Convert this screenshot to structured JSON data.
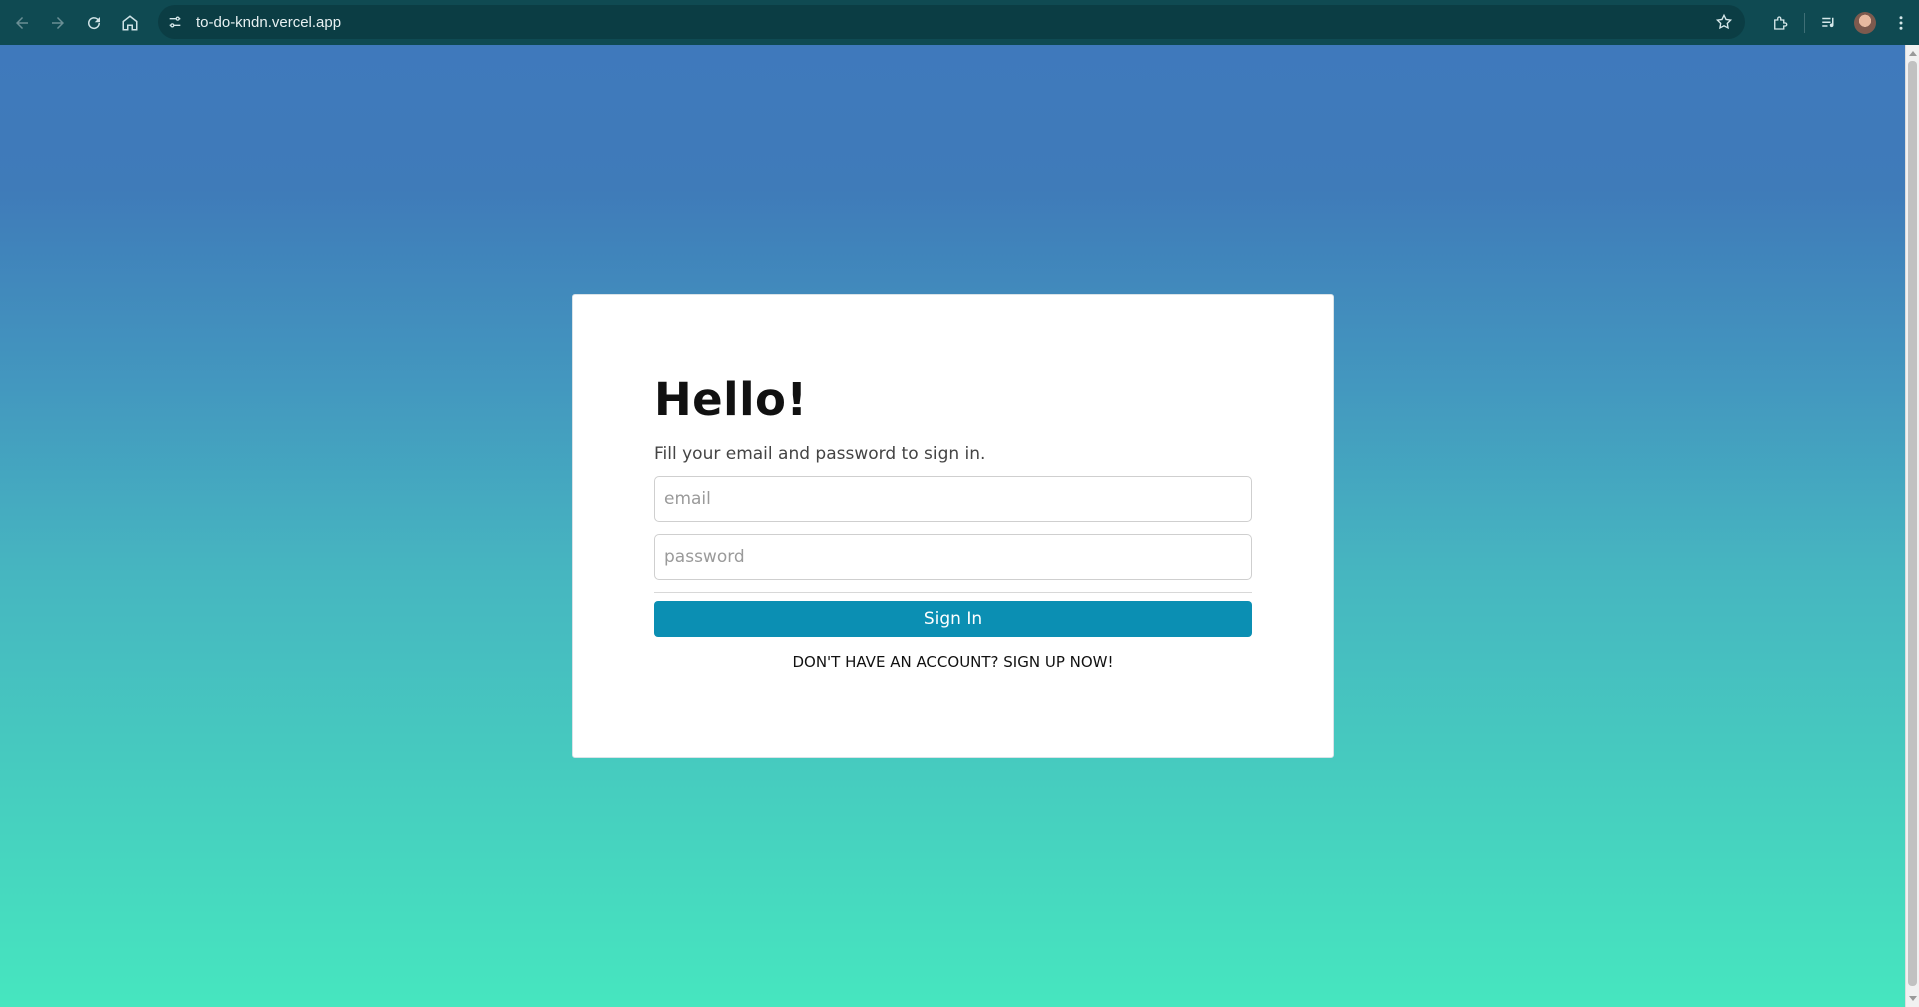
{
  "browser": {
    "url": "to-do-kndn.vercel.app"
  },
  "icons": {
    "back": "back-arrow-icon",
    "forward": "forward-arrow-icon",
    "reload": "reload-icon",
    "home": "home-icon",
    "site_info": "site-settings-icon",
    "bookmark": "star-icon",
    "extensions": "puzzle-icon",
    "media": "media-controls-icon",
    "menu": "kebab-menu-icon"
  },
  "colors": {
    "accent": "#0b8fb3",
    "gradient_top": "#3f79bc",
    "gradient_bottom": "#46e6bf"
  },
  "login": {
    "title": "Hello!",
    "subtitle": "Fill your email and password to sign in.",
    "email_placeholder": "email",
    "password_placeholder": "password",
    "sign_in_label": "Sign In",
    "signup_link": "DON'T HAVE AN ACCOUNT? SIGN UP NOW!"
  }
}
